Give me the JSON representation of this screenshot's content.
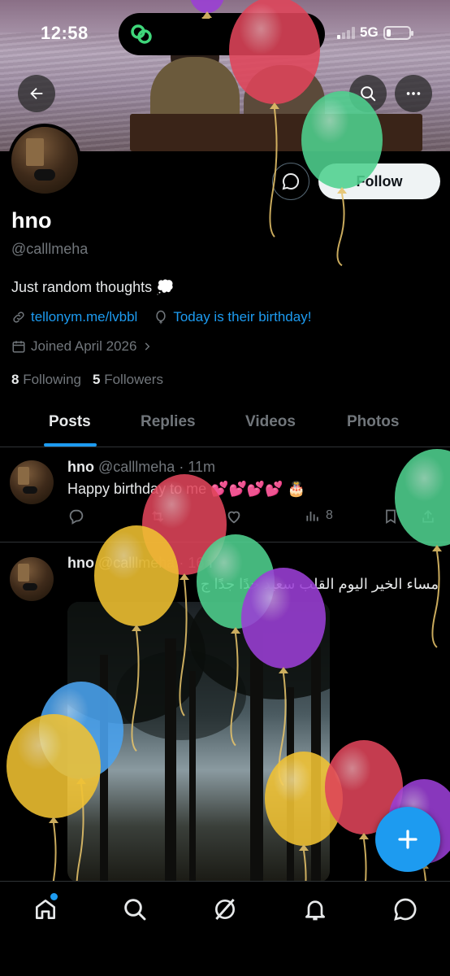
{
  "status_bar": {
    "time": "12:58",
    "network": "5G",
    "signal_bars_filled": 1,
    "battery_level": 0.2
  },
  "profile": {
    "display_name": "hno",
    "handle": "@calllmeha",
    "bio": "Just random thoughts 💭",
    "link": "tellonym.me/lvbbl",
    "birthday": "Today is their birthday!",
    "joined": "Joined April 2026",
    "following_count": "8",
    "following_label": "Following",
    "followers_count": "5",
    "followers_label": "Followers",
    "follow_label": "Follow"
  },
  "tabs": [
    "Posts",
    "Replies",
    "Videos",
    "Photos"
  ],
  "active_tab": "Posts",
  "posts": [
    {
      "name": "hno",
      "handle_time": "@calllmeha · 11m",
      "text": "Happy birthday to me 💕💕💕💕 🎂",
      "views": "8"
    },
    {
      "name": "hno",
      "handle_time": "@calllmeha · 16h",
      "text": "مساء الخير اليوم القلب سعيد جدًا جدًا ج"
    }
  ],
  "icons": {
    "back": "back-arrow-icon",
    "search": "search-icon",
    "more": "more-icon",
    "message": "message-icon",
    "link": "link-icon",
    "balloon": "balloon-icon",
    "calendar": "calendar-icon",
    "chevron": "chevron-right-icon",
    "nav": [
      "home-icon",
      "search-icon",
      "grok-icon",
      "notifications-icon",
      "messages-icon"
    ]
  },
  "colors": {
    "accent": "#1d9bf0",
    "muted": "#71767b",
    "balloon_red": "#e0455a",
    "balloon_green": "#4fd18f",
    "balloon_yellow": "#f1c232",
    "balloon_purple": "#9b3fd6",
    "balloon_blue": "#4aa3f0"
  }
}
